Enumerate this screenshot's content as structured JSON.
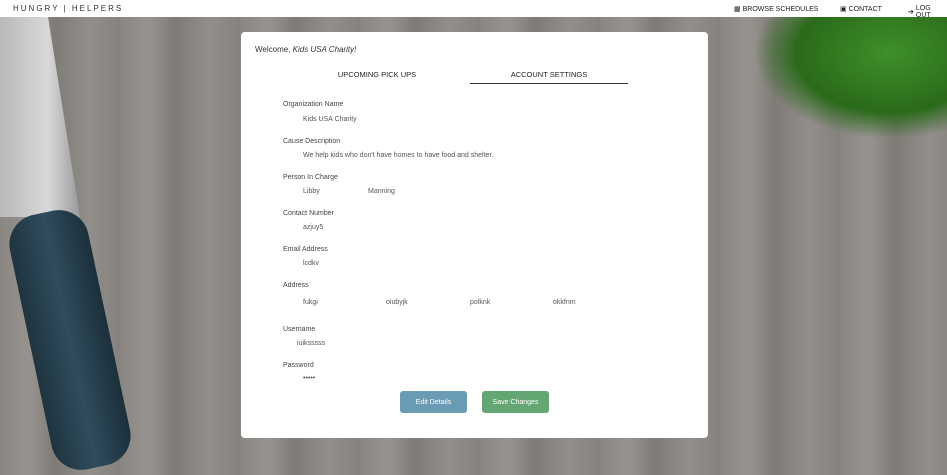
{
  "header": {
    "brand": "HUNGRY | HELPERS",
    "nav": [
      {
        "icon": "calendar-icon",
        "label": "BROWSE SCHEDULES"
      },
      {
        "icon": "contact-card-icon",
        "label": "CONTACT"
      },
      {
        "icon": "logout-icon",
        "label": "LOG OUT"
      }
    ]
  },
  "welcome": {
    "prefix": "Welcome, ",
    "name": "Kids USA Charity!"
  },
  "tabs": [
    {
      "label": "UPCOMING PICK UPS"
    },
    {
      "label": "ACCOUNT SETTINGS",
      "active": true
    }
  ],
  "form": {
    "org_label": "Organization Name",
    "org_value": "Kids USA Charity",
    "cause_label": "Cause Description",
    "cause_value": "We help kids who don't have homes to have food and shelter.",
    "person_label": "Person In Charge",
    "first_name": "Libby",
    "last_name": "Manning",
    "contact_label": "Contact Number",
    "contact_value": "azjuy5",
    "email_label": "Email Address",
    "email_value": "lcdkv",
    "address_label": "Address",
    "address": [
      "fukgi",
      "oiubyjk",
      "polknk",
      "okkfnm"
    ],
    "username_label": "Username",
    "username_value": "iuiksssss",
    "password_label": "Password",
    "password_value": "•••••"
  },
  "buttons": {
    "edit": "Edit Details",
    "save": "Save Changes"
  },
  "colors": {
    "edit": "#6a9bb5",
    "save": "#64a673"
  }
}
